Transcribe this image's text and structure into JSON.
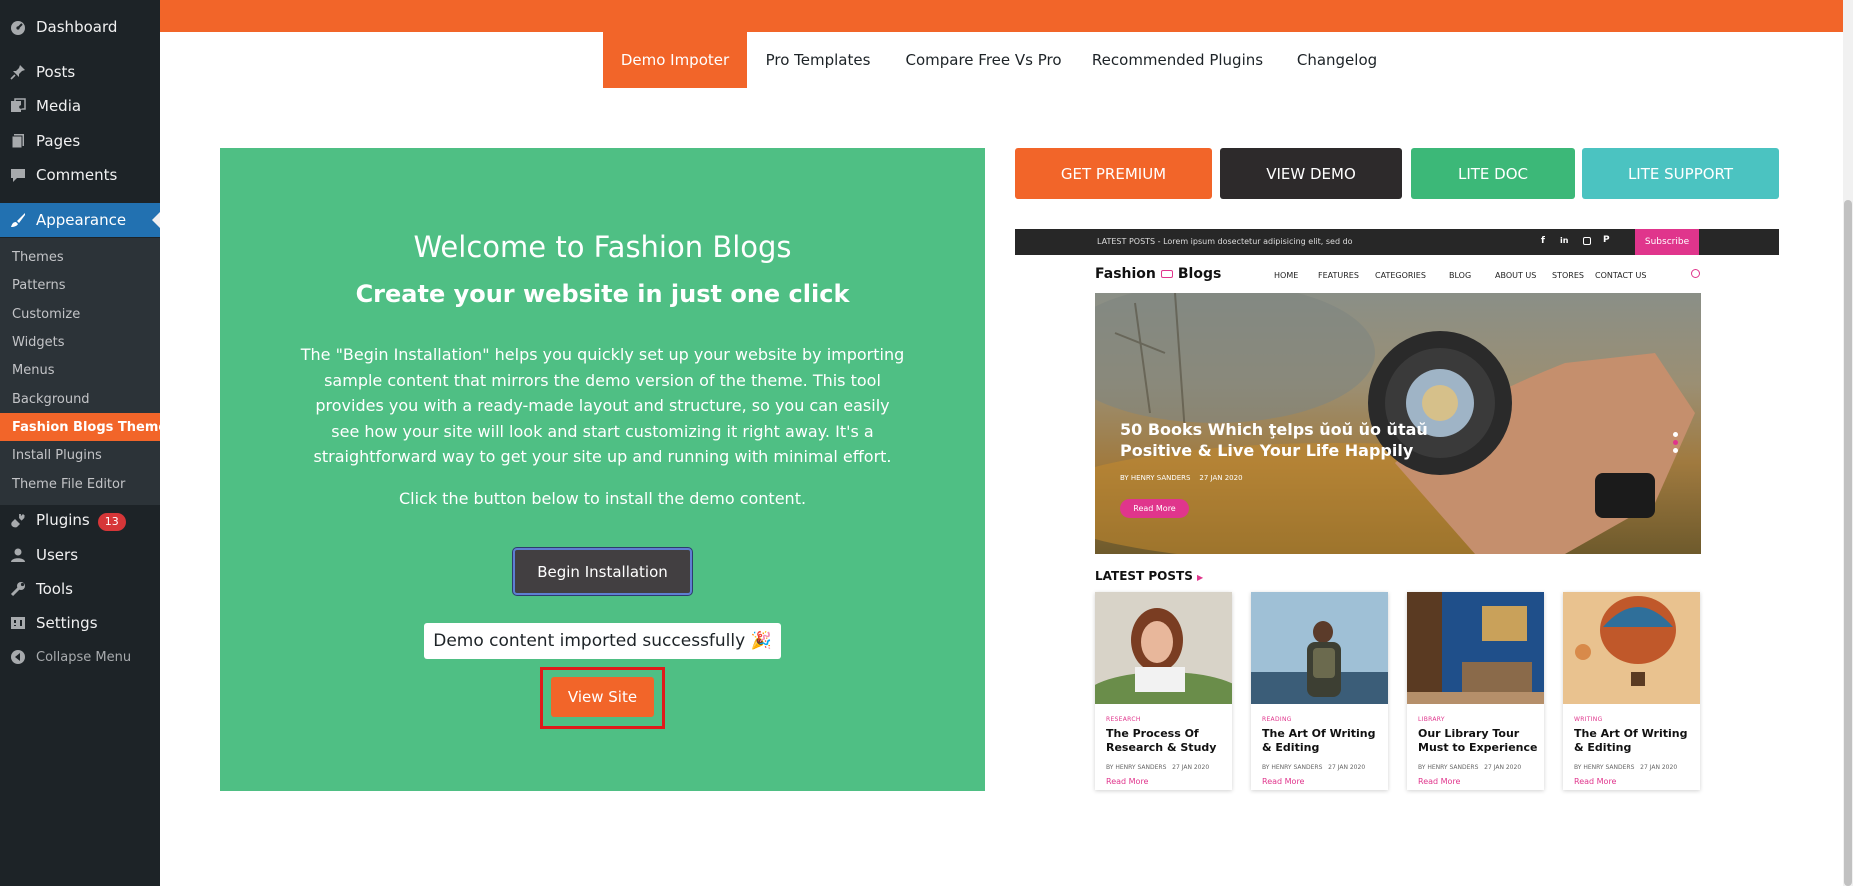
{
  "sidebar": {
    "dashboard": "Dashboard",
    "posts": "Posts",
    "media": "Media",
    "pages": "Pages",
    "comments": "Comments",
    "appearance": "Appearance",
    "submenu": [
      "Themes",
      "Patterns",
      "Customize",
      "Widgets",
      "Menus",
      "Background",
      "Fashion Blogs Theme",
      "Install Plugins",
      "Theme File Editor"
    ],
    "plugins": "Plugins",
    "plugins_badge": "13",
    "users": "Users",
    "tools": "Tools",
    "settings": "Settings",
    "collapse": "Collapse Menu"
  },
  "tabs": [
    "Demo Impoter",
    "Pro Templates",
    "Compare Free Vs Pro",
    "Recommended Plugins",
    "Changelog"
  ],
  "panel": {
    "title": "Welcome to Fashion Blogs",
    "subtitle": "Create your website in just one click",
    "description": "The \"Begin Installation\" helps you quickly set up your website by importing sample content that mirrors the demo version of the theme. This tool provides you with a ready-made layout and structure, so you can easily see how your site will look and start customizing it right away. It's a straightforward way to get your site up and running with minimal effort.",
    "click_text": "Click the button below to install the demo content.",
    "begin_button": "Begin Installation",
    "success": "Demo content imported successfully 🎉",
    "view_button": "View Site"
  },
  "actions": {
    "premium": "GET PREMIUM",
    "demo": "VIEW DEMO",
    "doc": "LITE DOC",
    "support": "LITE SUPPORT"
  },
  "preview": {
    "topbar_text": "LATEST POSTS - Lorem ipsum dosectetur adipisicing elit, sed do",
    "subscribe": "Subscribe",
    "logo_left": "Fashion",
    "logo_right": "Blogs",
    "nav": [
      "HOME",
      "FEATURES",
      "CATEGORIES",
      "BLOG",
      "ABOUT US",
      "STORES",
      "CONTACT US"
    ],
    "hero_title_1": "50 Books Which ţelps ŭoŭ ŭo ŭtaŭ",
    "hero_title_2": "Positive & Live Your Life Happily",
    "hero_meta_author": "BY HENRY SANDERS",
    "hero_meta_date": "27 JAN 2020",
    "hero_button": "Read More",
    "latest": "LATEST POSTS",
    "cards": [
      {
        "category": "RESEARCH",
        "title": "The Process Of Research & Study",
        "author": "BY HENRY SANDERS",
        "date": "27 JAN 2020",
        "more": "Read More"
      },
      {
        "category": "READING",
        "title": "The Art Of Writing & Editing",
        "author": "BY HENRY SANDERS",
        "date": "27 JAN 2020",
        "more": "Read More"
      },
      {
        "category": "LIBRARY",
        "title": "Our Library Tour Must to Experience",
        "author": "BY HENRY SANDERS",
        "date": "27 JAN 2020",
        "more": "Read More"
      },
      {
        "category": "WRITING",
        "title": "The Art Of Writing & Editing",
        "author": "BY HENRY SANDERS",
        "date": "27 JAN 2020",
        "more": "Read More"
      }
    ]
  },
  "colors": {
    "accent": "#f26529",
    "panel_green": "#4fbf84",
    "dark_button": "#2d2a2b",
    "doc_green": "#3cb878",
    "support_teal": "#4bc3c1",
    "wp_sidebar": "#1d2327",
    "wp_blue": "#2271b1"
  }
}
